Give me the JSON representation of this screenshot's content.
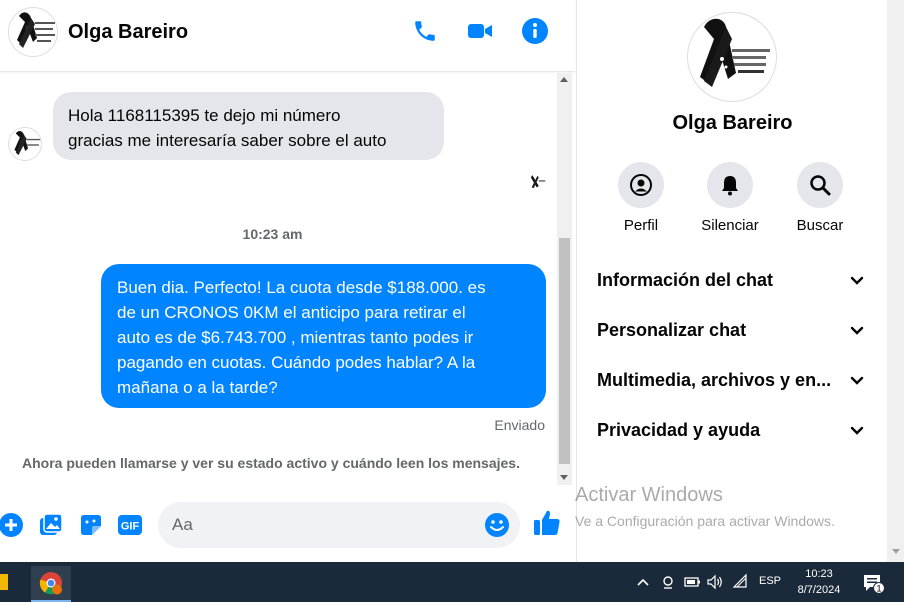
{
  "contact": {
    "name": "Olga Bareiro"
  },
  "messages": {
    "incoming": [
      "Hola 1168115395 te dejo mi número",
      "gracias me interesaría saber sobre el auto"
    ],
    "timestamp": "10:23 am",
    "outgoing": [
      "Buen dia. Perfecto! La cuota desde $188.000. es",
      "de un CRONOS 0KM el anticipo para retirar el",
      "auto es de $6.743.700 , mientras tanto podes ir",
      "pagando en cuotas. Cuándo podes hablar? A la",
      "mañana o a la tarde?"
    ],
    "status": "Enviado",
    "info_line": "Ahora pueden llamarse y ver su estado activo y cuándo leen los mensajes."
  },
  "composer": {
    "placeholder": "Aa",
    "gif_label": "GIF"
  },
  "panel": {
    "name": "Olga Bareiro",
    "actions": [
      "Perfil",
      "Silenciar",
      "Buscar"
    ],
    "sections": [
      "Información del chat",
      "Personalizar chat",
      "Multimedia, archivos y en...",
      "Privacidad y ayuda"
    ]
  },
  "watermark": {
    "title": "Activar Windows",
    "subtitle": "Ve a Configuración para activar Windows."
  },
  "taskbar": {
    "lang": "ESP",
    "time": "10:23",
    "date": "8/7/2024",
    "notifications": "1"
  },
  "colors": {
    "accent": "#0084ff",
    "incoming_bubble": "#e4e6eb",
    "taskbar": "#1b2a3a"
  }
}
